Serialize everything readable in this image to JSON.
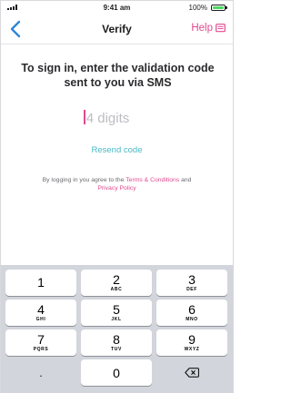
{
  "status_bar": {
    "time": "9:41 am",
    "battery": "100%"
  },
  "nav": {
    "title": "Verify",
    "help_label": "Help"
  },
  "main": {
    "headline": "To sign in, enter the validation code sent to you via SMS",
    "code_placeholder": "4 digits",
    "resend_label": "Resend code",
    "terms": {
      "prefix": "By logging in you agree to the ",
      "terms_link": "Terms & Conditions",
      "and": " and ",
      "privacy_link": "Privacy Policy"
    }
  },
  "keypad": {
    "rows": [
      [
        {
          "digit": "1",
          "letters": ""
        },
        {
          "digit": "2",
          "letters": "ABC"
        },
        {
          "digit": "3",
          "letters": "DEF"
        }
      ],
      [
        {
          "digit": "4",
          "letters": "GHI"
        },
        {
          "digit": "5",
          "letters": "JKL"
        },
        {
          "digit": "6",
          "letters": "MNO"
        }
      ],
      [
        {
          "digit": "7",
          "letters": "PQRS"
        },
        {
          "digit": "8",
          "letters": "TUV"
        },
        {
          "digit": "9",
          "letters": "WXYZ"
        }
      ]
    ],
    "dot_label": ".",
    "zero": "0",
    "delete_icon": "backspace-icon"
  },
  "colors": {
    "accent_pink": "#e0488f",
    "accent_teal": "#4ab8c4",
    "back_blue": "#2f86d6",
    "battery_green": "#4cd964"
  }
}
